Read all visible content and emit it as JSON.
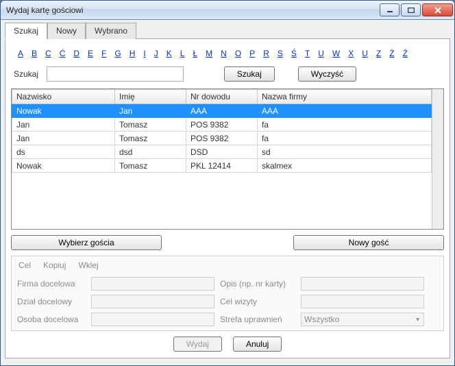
{
  "window": {
    "title": "Wydaj kartę gościowi"
  },
  "tabs": [
    {
      "label": "Szukaj",
      "active": true
    },
    {
      "label": "Nowy",
      "active": false
    },
    {
      "label": "Wybrano",
      "active": false
    }
  ],
  "letters": [
    "A",
    "B",
    "C",
    "Ć",
    "D",
    "E",
    "F",
    "G",
    "H",
    "I",
    "J",
    "K",
    "L",
    "Ł",
    "M",
    "N",
    "O",
    "P",
    "R",
    "S",
    "Ś",
    "T",
    "U",
    "W",
    "X",
    "U",
    "Z",
    "Ż",
    "Ź"
  ],
  "search": {
    "label": "Szukaj",
    "value": "",
    "search_btn": "Szukaj",
    "clear_btn": "Wyczyść"
  },
  "table": {
    "headers": [
      "Nazwisko",
      "Imię",
      "Nr dowodu",
      "Nazwa firmy"
    ],
    "rows": [
      {
        "cells": [
          "Nowak",
          "Jan",
          "AAA",
          "AAA"
        ],
        "selected": true
      },
      {
        "cells": [
          "Jan",
          "Tomasz",
          "POS 9382",
          "fa"
        ],
        "selected": false
      },
      {
        "cells": [
          "Jan",
          "Tomasz",
          "POS 9382",
          "fa"
        ],
        "selected": false
      },
      {
        "cells": [
          "ds",
          "dsd",
          "DSD",
          "sd"
        ],
        "selected": false
      },
      {
        "cells": [
          "Nowak",
          "Tomasz",
          "PKL 12414",
          "skalmex"
        ],
        "selected": false
      }
    ]
  },
  "mid_buttons": {
    "select_guest": "Wybierz gościa",
    "new_guest": "Nowy gość"
  },
  "form_menu": {
    "cel": "Cel",
    "copy": "Kopiuj",
    "paste": "Wklej"
  },
  "form": {
    "firma_label": "Firma docelowa",
    "dzial_label": "Dział docelowy",
    "osoba_label": "Osoba docelowa",
    "opis_label": "Opis (np. nr karty)",
    "celwizyty_label": "Cel wizyty",
    "strefa_label": "Strefa uprawnień",
    "strefa_value": "Wszystko"
  },
  "footer": {
    "issue": "Wydaj",
    "cancel": "Anuluj"
  }
}
